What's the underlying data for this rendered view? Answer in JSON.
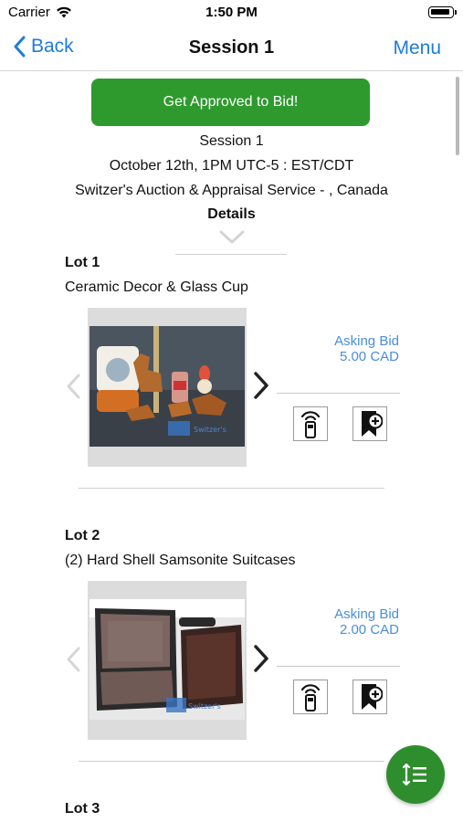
{
  "status_bar": {
    "carrier": "Carrier",
    "time": "1:50 PM"
  },
  "nav": {
    "back_label": "Back",
    "title": "Session 1",
    "menu_label": "Menu"
  },
  "approve_button_label": "Get Approved to Bid!",
  "session": {
    "name": "Session 1",
    "datetime": "October 12th, 1PM UTC-5 : EST/CDT",
    "auctioneer": "Switzer's Auction & Appraisal Service - , Canada",
    "details_label": "Details"
  },
  "lots": [
    {
      "label": "Lot 1",
      "description": "Ceramic Decor & Glass Cup",
      "bid_label": "Asking Bid",
      "bid_value": "5.00 CAD"
    },
    {
      "label": "Lot 2",
      "description": "(2) Hard Shell Samsonite Suitcases",
      "bid_label": "Asking Bid",
      "bid_value": "2.00 CAD"
    },
    {
      "label": "Lot 3"
    }
  ],
  "colors": {
    "accent_blue": "#1e7be0",
    "bid_blue": "#4a8ed8",
    "approve_green": "#2e9a2e",
    "fab_green": "#2e8e2e"
  },
  "icons": {
    "back": "chevron-left-icon",
    "details": "chevron-down-icon",
    "photo_prev": "chevron-left-icon",
    "photo_next": "chevron-right-icon",
    "remote_bid": "remote-bid-icon",
    "watchlist": "bookmark-add-icon",
    "sort": "sort-list-icon"
  }
}
